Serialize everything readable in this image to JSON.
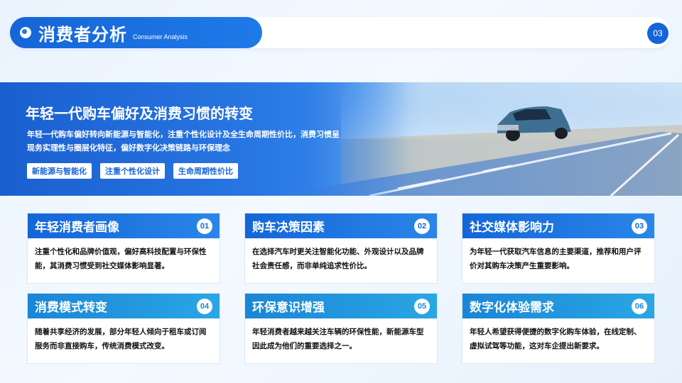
{
  "header": {
    "title": "消费者分析",
    "subtitle": "Consumer Analysis",
    "page_number": "03"
  },
  "hero": {
    "title": "年轻一代购车偏好及消费习惯的转变",
    "description": "年轻一代购车偏好转向新能源与智能化，注重个性化设计及全生命周期性价比，消费习惯呈现务实理性与圈层化特征，偏好数字化决策链路与环保理念",
    "tags": [
      "新能源与智能化",
      "注重个性化设计",
      "生命周期性价比"
    ]
  },
  "cards": [
    {
      "title": "年轻消费者画像",
      "num": "01",
      "body": "注重个性化和品牌价值观，偏好高科技配置与环保性能，其消费习惯受到社交媒体影响显著。"
    },
    {
      "title": "购车决策因素",
      "num": "02",
      "body": "在选择汽车时更关注智能化功能、外观设计以及品牌社会责任感，而非单纯追求性价比。"
    },
    {
      "title": "社交媒体影响力",
      "num": "03",
      "body": "为年轻一代获取汽车信息的主要渠道，推荐和用户评价对其购车决策产生重要影响。"
    },
    {
      "title": "消费模式转变",
      "num": "04",
      "body": "随着共享经济的发展，部分年轻人倾向于租车或订阅服务而非直接购车，传统消费模式改变。"
    },
    {
      "title": "环保意识增强",
      "num": "05",
      "body": "年轻消费者越来越关注车辆的环保性能，新能源车型因此成为他们的重要选择之一。"
    },
    {
      "title": "数字化体验需求",
      "num": "06",
      "body": "年轻人希望获得便捷的数字化购车体验，在线定制、虚拟试驾等功能，这对车企提出新要求。"
    }
  ],
  "colors": {
    "primary": "#1565d8",
    "card_head_top": "#1a6fe0",
    "card_head_bottom": "#1e9ad8"
  }
}
